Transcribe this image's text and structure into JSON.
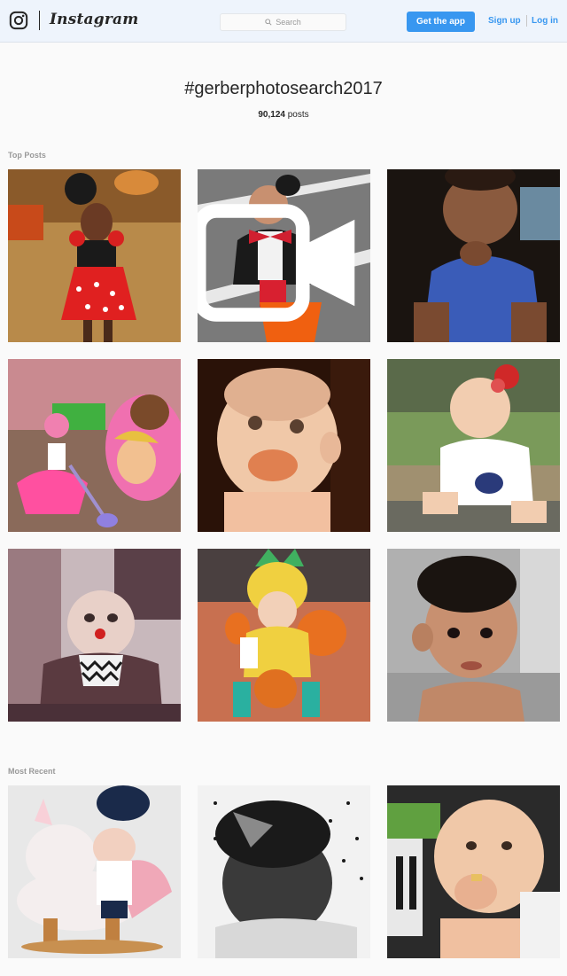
{
  "header": {
    "wordmark": "Instagram",
    "search_placeholder": "Search",
    "get_app_label": "Get the app",
    "signup_label": "Sign up",
    "login_label": "Log in"
  },
  "tag": {
    "name": "#gerberphotosearch2017",
    "post_count": "90,124",
    "post_count_suffix": " posts"
  },
  "sections": {
    "top_posts_label": "Top Posts",
    "most_recent_label": "Most Recent"
  },
  "colors": {
    "accent": "#3897f0",
    "background": "#fafafa"
  }
}
